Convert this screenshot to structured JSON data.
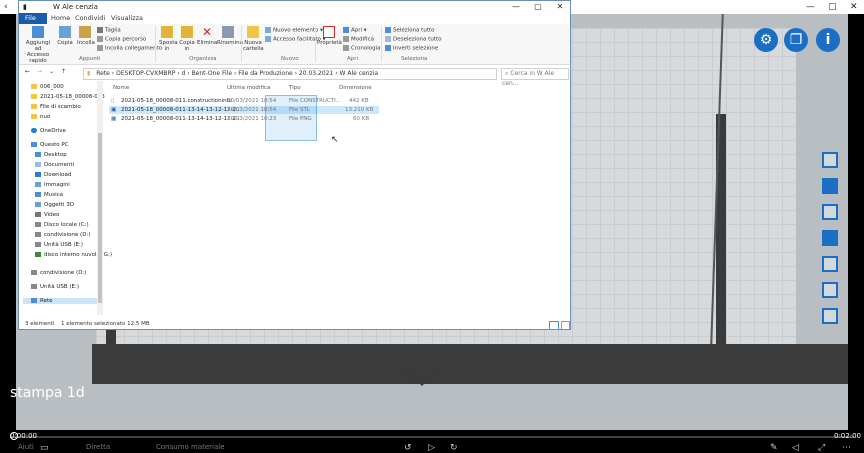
{
  "window": {
    "title": "W Ale cenzia",
    "tabs": [
      "File",
      "Home",
      "Condividi",
      "Visualizza"
    ]
  },
  "ribbon": {
    "groups": [
      "Appunti",
      "Organizza",
      "Nuovo",
      "Apri",
      "Seleziona"
    ],
    "appunti": {
      "pin_label": "Aggiungi ad Accesso rapido",
      "copy_label": "Copia",
      "paste_label": "Incolla",
      "cut_label": "Taglia",
      "copy_path_label": "Copia percorso",
      "paste_link_label": "Incolla collegamento"
    },
    "organizza": {
      "move_label": "Sposta in",
      "copy_to_label": "Copia in",
      "delete_label": "Elimina",
      "rename_label": "Rinomina"
    },
    "nuovo": {
      "new_folder_label": "Nuova cartella",
      "new_item_label": "Nuovo elemento",
      "easy_access_label": "Accesso facilitato"
    },
    "apri": {
      "properties_label": "Proprietà",
      "open_label": "Apri",
      "edit_label": "Modifica",
      "history_label": "Cronologia"
    },
    "seleziona": {
      "select_all_label": "Seleziona tutto",
      "select_none_label": "Deseleziona tutto",
      "invert_label": "Inverti selezione"
    }
  },
  "address": {
    "path": [
      "Rete",
      "DESKTOP-CVXMBRP",
      "d",
      "Bent-One File",
      "File da Produzione",
      "20.03.2021",
      "W Ale cenzia"
    ],
    "search_placeholder": "Cerca in W Ale cen..."
  },
  "nav": {
    "items": [
      "006_000",
      "2021-05-18_00008-003",
      "File di scambio",
      "nuo",
      "OneDrive",
      "Questo PC",
      "Desktop",
      "Documenti",
      "Download",
      "Immagini",
      "Musica",
      "Oggetti 3D",
      "Video",
      "Disco locale (C:)",
      "condivisione (D:)",
      "Unità USB (E:)",
      "disco interno nuvola (G:)",
      "condivisione (D:)",
      "Unità USB (E:)",
      "Rete"
    ]
  },
  "files": {
    "columns": [
      "Nome",
      "Ultima modifica",
      "Tipo",
      "Dimensione"
    ],
    "rows": [
      {
        "name": "2021-05-18_00008-011.constructioninfo",
        "date": "20/03/2021 10:54",
        "type": "File CONSTRUCTI...",
        "size": "442 KB"
      },
      {
        "name": "2021-05-18_00008-011-13-14-13-12-11-2...",
        "date": "20/03/2021 10:54",
        "type": "File STL",
        "size": "13.210 KB"
      },
      {
        "name": "2021-05-18_00008-011-13-14-13-12-11-2...",
        "date": "20/03/2021 10:23",
        "type": "File PNG",
        "size": "60 KB"
      }
    ]
  },
  "status": {
    "count": "3 elementi",
    "selected": "1 elemento selezionato  12,5 MB"
  },
  "overlay": {
    "label": "stampa 1d"
  },
  "video": {
    "time_start": "0:00:00",
    "time_end": "0:02:00",
    "bottom_labels": [
      "Aiuti",
      "Diretta",
      "Consumo materiale"
    ]
  },
  "colors": {
    "accent": "#1a6fc4",
    "file_tab": "#1a5bab",
    "selection": "#cce8ff"
  }
}
